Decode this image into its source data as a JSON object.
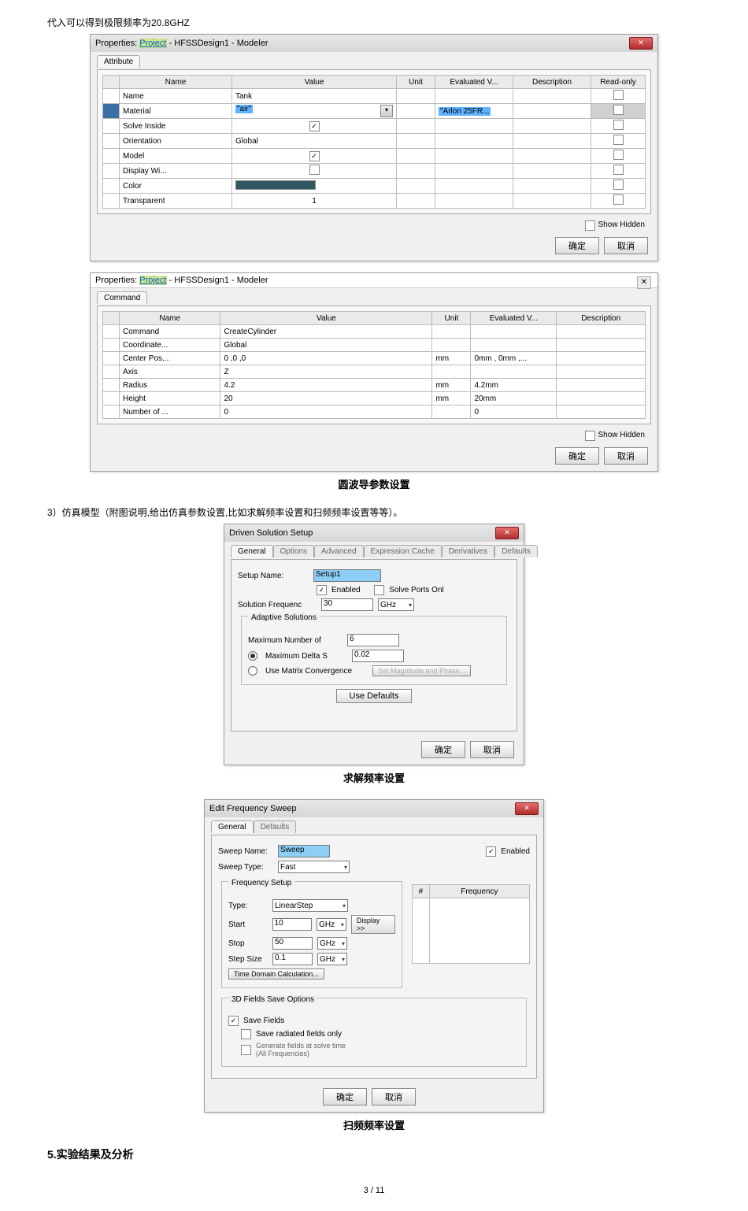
{
  "top_line": "代入可以得到极限频率为20.8GHZ",
  "dlg1": {
    "title_prefix": "Properties: ",
    "title_proj": "Project",
    "title_suffix": " - HFSSDesign1 - Modeler",
    "tab": "Attribute",
    "headers": [
      "Name",
      "Value",
      "Unit",
      "Evaluated V...",
      "Description",
      "Read-only"
    ],
    "rows": [
      {
        "name": "Name",
        "value": "Tank"
      },
      {
        "name": "Material",
        "value": "\"air\"",
        "eval": "\"Arlon 25FR...",
        "selected": true,
        "hasDropdown": true,
        "readonlyShaded": true
      },
      {
        "name": "Solve Inside",
        "checkbox": true,
        "checked": true
      },
      {
        "name": "Orientation",
        "value": "Global"
      },
      {
        "name": "Model",
        "checkbox": true,
        "checked": true
      },
      {
        "name": "Display Wi...",
        "checkbox": true,
        "checked": false
      },
      {
        "name": "Color",
        "swatch": true
      },
      {
        "name": "Transparent",
        "value": "1"
      }
    ],
    "show_hidden": "Show Hidden",
    "ok": "确定",
    "cancel": "取消"
  },
  "dlg2": {
    "title_prefix": "Properties: ",
    "title_proj": "Project",
    "title_suffix": " - HFSSDesign1 - Modeler",
    "tab": "Command",
    "headers": [
      "Name",
      "Value",
      "Unit",
      "Evaluated V...",
      "Description"
    ],
    "rows": [
      {
        "name": "Command",
        "value": "CreateCylinder"
      },
      {
        "name": "Coordinate...",
        "value": "Global"
      },
      {
        "name": "Center Pos...",
        "value": "0 ,0 ,0",
        "unit": "mm",
        "eval": "0mm , 0mm ,..."
      },
      {
        "name": "Axis",
        "value": "Z"
      },
      {
        "name": "Radius",
        "value": "4.2",
        "unit": "mm",
        "eval": "4.2mm"
      },
      {
        "name": "Height",
        "value": "20",
        "unit": "mm",
        "eval": "20mm"
      },
      {
        "name": "Number of ...",
        "value": "0",
        "eval": "0"
      }
    ],
    "show_hidden": "Show Hidden",
    "ok": "确定",
    "cancel": "取消"
  },
  "caption1": "圆波导参数设置",
  "section3_intro": "3）仿真模型（附图说明,给出仿真参数设置,比如求解频率设置和扫频频率设置等等）。",
  "dlg3": {
    "title": "Driven Solution Setup",
    "tabs": [
      "General",
      "Options",
      "Advanced",
      "Expression Cache",
      "Derivatives",
      "Defaults"
    ],
    "setup_name_label": "Setup Name:",
    "setup_name_value": "Setup1",
    "enabled_label": "Enabled",
    "solve_ports_label": "Solve Ports Onl",
    "sol_freq_label": "Solution Frequenc",
    "sol_freq_value": "30",
    "sol_freq_unit": "GHz",
    "adaptive_label": "Adaptive Solutions",
    "max_num_label": "Maximum Number of",
    "max_num_value": "6",
    "max_delta_label": "Maximum Delta S",
    "max_delta_value": "0.02",
    "matrix_conv_label": "Use Matrix Convergence",
    "set_mag_btn": "Set Magnitude and Phase...",
    "use_defaults": "Use Defaults",
    "ok": "确定",
    "cancel": "取消"
  },
  "caption2": "求解频率设置",
  "dlg4": {
    "title": "Edit Frequency Sweep",
    "tabs": [
      "General",
      "Defaults"
    ],
    "sweep_name_label": "Sweep Name:",
    "sweep_name_value": "Sweep",
    "enabled_label": "Enabled",
    "sweep_type_label": "Sweep Type:",
    "sweep_type_value": "Fast",
    "freq_setup_label": "Frequency Setup",
    "type_label": "Type:",
    "type_value": "LinearStep",
    "start_label": "Start",
    "start_value": "10",
    "start_unit": "GHz",
    "stop_label": "Stop",
    "stop_value": "50",
    "stop_unit": "GHz",
    "step_label": "Step Size",
    "step_value": "0.1",
    "step_unit": "GHz",
    "display_btn": "Display >>",
    "time_domain_btn": "Time Domain Calculation...",
    "table_headers": [
      "#",
      "Frequency"
    ],
    "save_opts_label": "3D Fields Save Options",
    "save_fields_label": "Save Fields",
    "save_radiated_label": "Save radiated fields only",
    "generate_label": "Generate fields at solve time (All Frequencies)",
    "ok": "确定",
    "cancel": "取消"
  },
  "caption3": "扫频频率设置",
  "section5": "5.实验结果及分析",
  "page_indicator": "3 / 11"
}
